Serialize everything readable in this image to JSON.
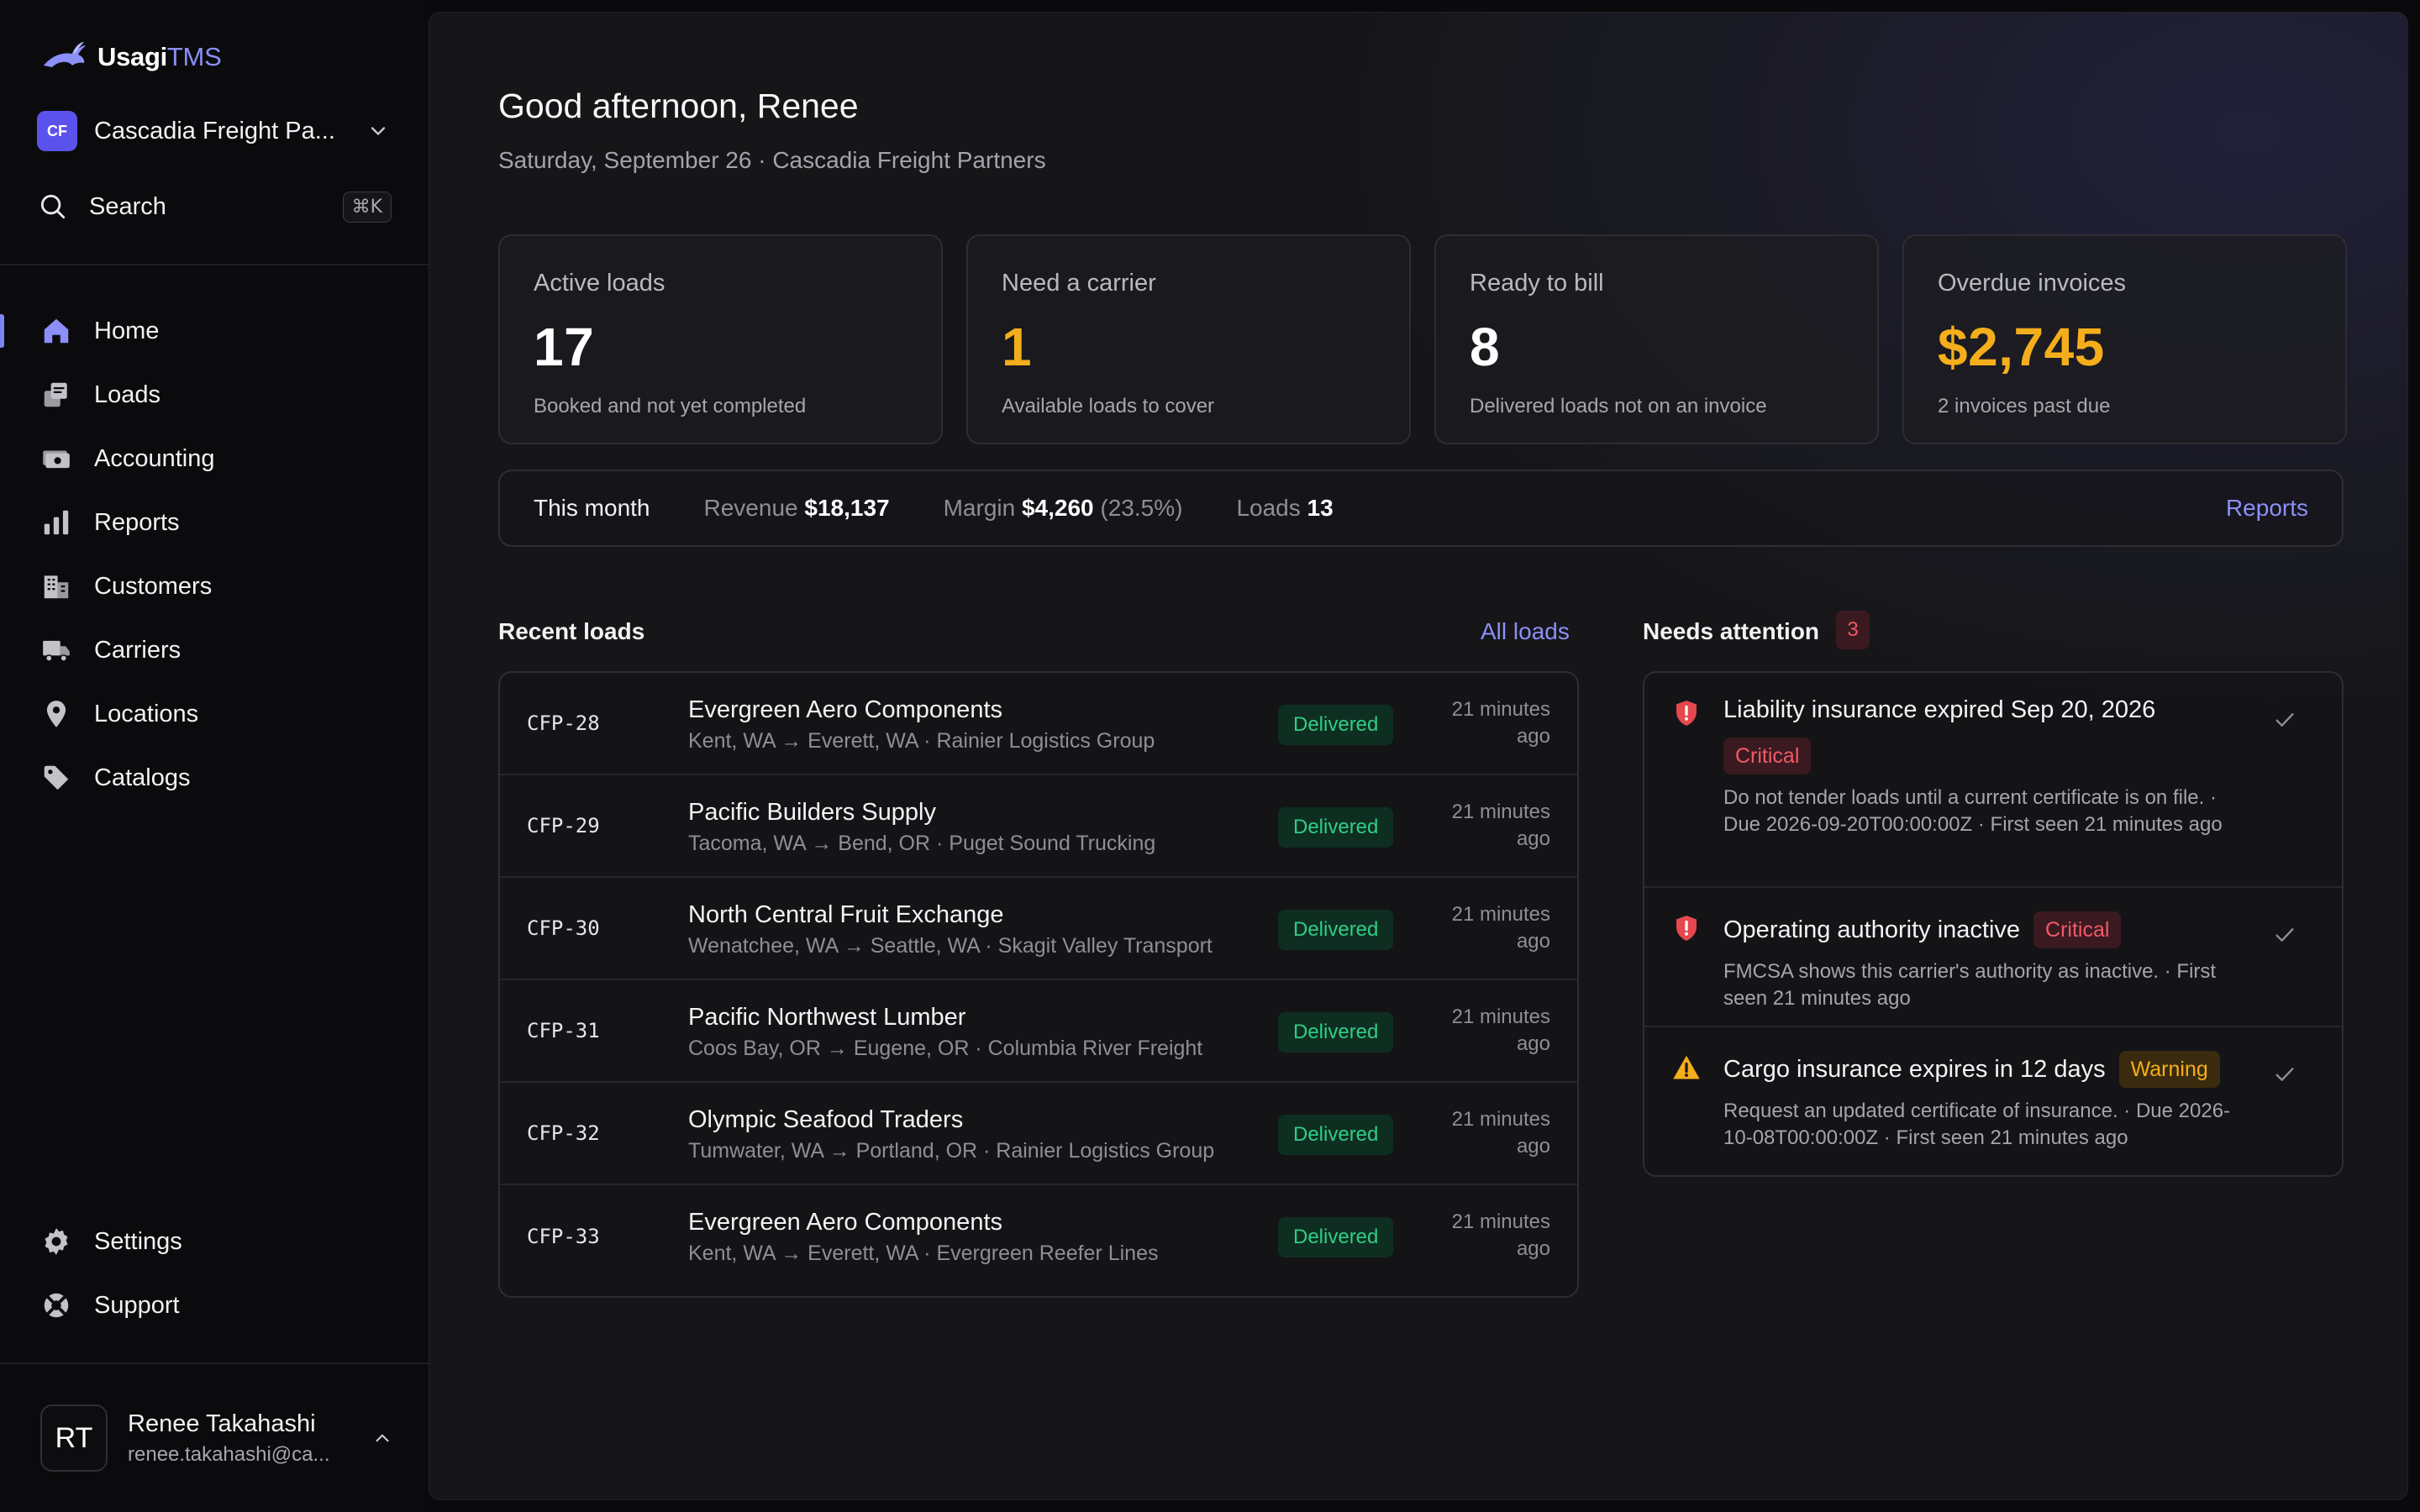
{
  "brand": {
    "name": "Usagi",
    "accent": "TMS"
  },
  "org": {
    "initials": "CF",
    "name": "Cascadia Freight Pa..."
  },
  "search": {
    "label": "Search",
    "shortcut": "⌘K"
  },
  "nav": [
    {
      "label": "Home",
      "icon": "home-icon",
      "active": true
    },
    {
      "label": "Loads",
      "icon": "loads-icon"
    },
    {
      "label": "Accounting",
      "icon": "accounting-icon"
    },
    {
      "label": "Reports",
      "icon": "reports-icon"
    },
    {
      "label": "Customers",
      "icon": "customers-icon"
    },
    {
      "label": "Carriers",
      "icon": "carriers-icon"
    },
    {
      "label": "Locations",
      "icon": "location-pin-icon"
    },
    {
      "label": "Catalogs",
      "icon": "tag-icon"
    }
  ],
  "nav_bottom": [
    {
      "label": "Settings",
      "icon": "gear-icon"
    },
    {
      "label": "Support",
      "icon": "lifebuoy-icon"
    }
  ],
  "user": {
    "initials": "RT",
    "name": "Renee Takahashi",
    "email": "renee.takahashi@ca..."
  },
  "header": {
    "greeting": "Good afternoon, Renee",
    "subline": "Saturday, September 26 · Cascadia Freight Partners"
  },
  "stats": [
    {
      "title": "Active loads",
      "value": "17",
      "desc": "Booked and not yet completed",
      "highlight": false
    },
    {
      "title": "Need a carrier",
      "value": "1",
      "desc": "Available loads to cover",
      "highlight": true
    },
    {
      "title": "Ready to bill",
      "value": "8",
      "desc": "Delivered loads not on an invoice",
      "highlight": false
    },
    {
      "title": "Overdue invoices",
      "value": "$2,745",
      "desc": "2 invoices past due",
      "highlight": true
    }
  ],
  "month": {
    "label": "This month",
    "revenue_label": "Revenue",
    "revenue": "$18,137",
    "margin_label": "Margin",
    "margin": "$4,260",
    "margin_pct": "(23.5%)",
    "loads_label": "Loads",
    "loads": "13",
    "link": "Reports"
  },
  "recent": {
    "title": "Recent loads",
    "link": "All loads",
    "rows": [
      {
        "id": "CFP-28",
        "customer": "Evergreen Aero Components",
        "route": "Kent, WA → Everett, WA · Rainier Logistics Group",
        "status": "Delivered",
        "time1": "21 minutes",
        "time2": "ago"
      },
      {
        "id": "CFP-29",
        "customer": "Pacific Builders Supply",
        "route": "Tacoma, WA → Bend, OR · Puget Sound Trucking",
        "status": "Delivered",
        "time1": "21 minutes",
        "time2": "ago"
      },
      {
        "id": "CFP-30",
        "customer": "North Central Fruit Exchange",
        "route": "Wenatchee, WA → Seattle, WA · Skagit Valley Transport",
        "status": "Delivered",
        "time1": "21 minutes",
        "time2": "ago"
      },
      {
        "id": "CFP-31",
        "customer": "Pacific Northwest Lumber",
        "route": "Coos Bay, OR → Eugene, OR · Columbia River Freight",
        "status": "Delivered",
        "time1": "21 minutes",
        "time2": "ago"
      },
      {
        "id": "CFP-32",
        "customer": "Olympic Seafood Traders",
        "route": "Tumwater, WA → Portland, OR · Rainier Logistics Group",
        "status": "Delivered",
        "time1": "21 minutes",
        "time2": "ago"
      },
      {
        "id": "CFP-33",
        "customer": "Evergreen Aero Components",
        "route": "Kent, WA → Everett, WA · Evergreen Reefer Lines",
        "status": "Delivered",
        "time1": "21 minutes",
        "time2": "ago"
      }
    ]
  },
  "attention": {
    "title": "Needs attention",
    "count": "3",
    "items": [
      {
        "title": "Liability insurance expired Sep 20, 2026",
        "severity": "Critical",
        "text": "Do not tender loads until a current certificate is on file. · Due 2026-09-20T00:00:00Z · First seen 21 minutes ago"
      },
      {
        "title": "Operating authority inactive",
        "severity": "Critical",
        "text": "FMCSA shows this carrier's authority as inactive. · First seen 21 minutes ago"
      },
      {
        "title": "Cargo insurance expires in 12 days",
        "severity": "Warning",
        "text": "Request an updated certificate of insurance. · Due 2026-10-08T00:00:00Z · First seen 21 minutes ago"
      }
    ]
  },
  "colors": {
    "accent": "#8b8ff7",
    "warning": "#f5ae1b",
    "critical": "#f05a67",
    "success": "#2fce86"
  }
}
